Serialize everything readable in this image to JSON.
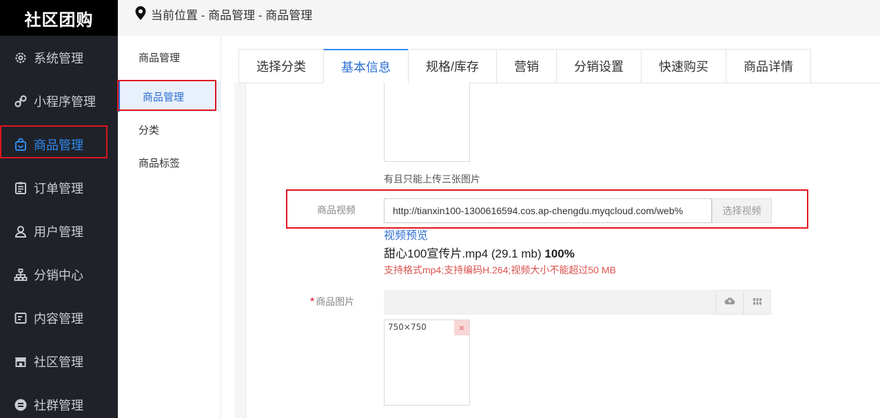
{
  "app": {
    "brand": "社区团购"
  },
  "sidebar": {
    "items": [
      {
        "label": "系统管理",
        "icon": "gear-icon"
      },
      {
        "label": "小程序管理",
        "icon": "miniprogram-icon"
      },
      {
        "label": "商品管理",
        "icon": "bag-icon",
        "active": true
      },
      {
        "label": "订单管理",
        "icon": "clipboard-icon"
      },
      {
        "label": "用户管理",
        "icon": "user-icon"
      },
      {
        "label": "分销中心",
        "icon": "hierarchy-icon"
      },
      {
        "label": "内容管理",
        "icon": "content-icon"
      },
      {
        "label": "社区管理",
        "icon": "store-icon"
      },
      {
        "label": "社群管理",
        "icon": "group-icon"
      }
    ]
  },
  "breadcrumb": {
    "text": "当前位置 - 商品管理 - 商品管理"
  },
  "submenu": {
    "title": "商品管理",
    "items": [
      {
        "label": "商品管理",
        "active": true
      },
      {
        "label": "分类"
      },
      {
        "label": "商品标签"
      }
    ]
  },
  "tabs": [
    {
      "label": "选择分类"
    },
    {
      "label": "基本信息",
      "active": true
    },
    {
      "label": "规格/库存"
    },
    {
      "label": "营销"
    },
    {
      "label": "分销设置"
    },
    {
      "label": "快速购买"
    },
    {
      "label": "商品详情"
    }
  ],
  "form": {
    "upload_hint": "有且只能上传三张图片",
    "video": {
      "label": "商品视频",
      "url": "http://tianxin100-1300616594.cos.ap-chengdu.myqcloud.com/web%",
      "button": "选择视频",
      "preview": "视频预览",
      "file_name": "甜心100宣传片.mp4 (29.1 mb)",
      "progress": "100%",
      "progress_value": 100,
      "hint": "支持格式mp4;支持编码H.264;视频大小不能超过50 MB"
    },
    "image": {
      "required_mark": "*",
      "label": "商品图片",
      "size_hint": "750×750",
      "delete_symbol": "×"
    }
  },
  "colors": {
    "accent": "#2d6fd1",
    "sidebar_bg": "#20222a",
    "highlight": "#e0141e"
  }
}
